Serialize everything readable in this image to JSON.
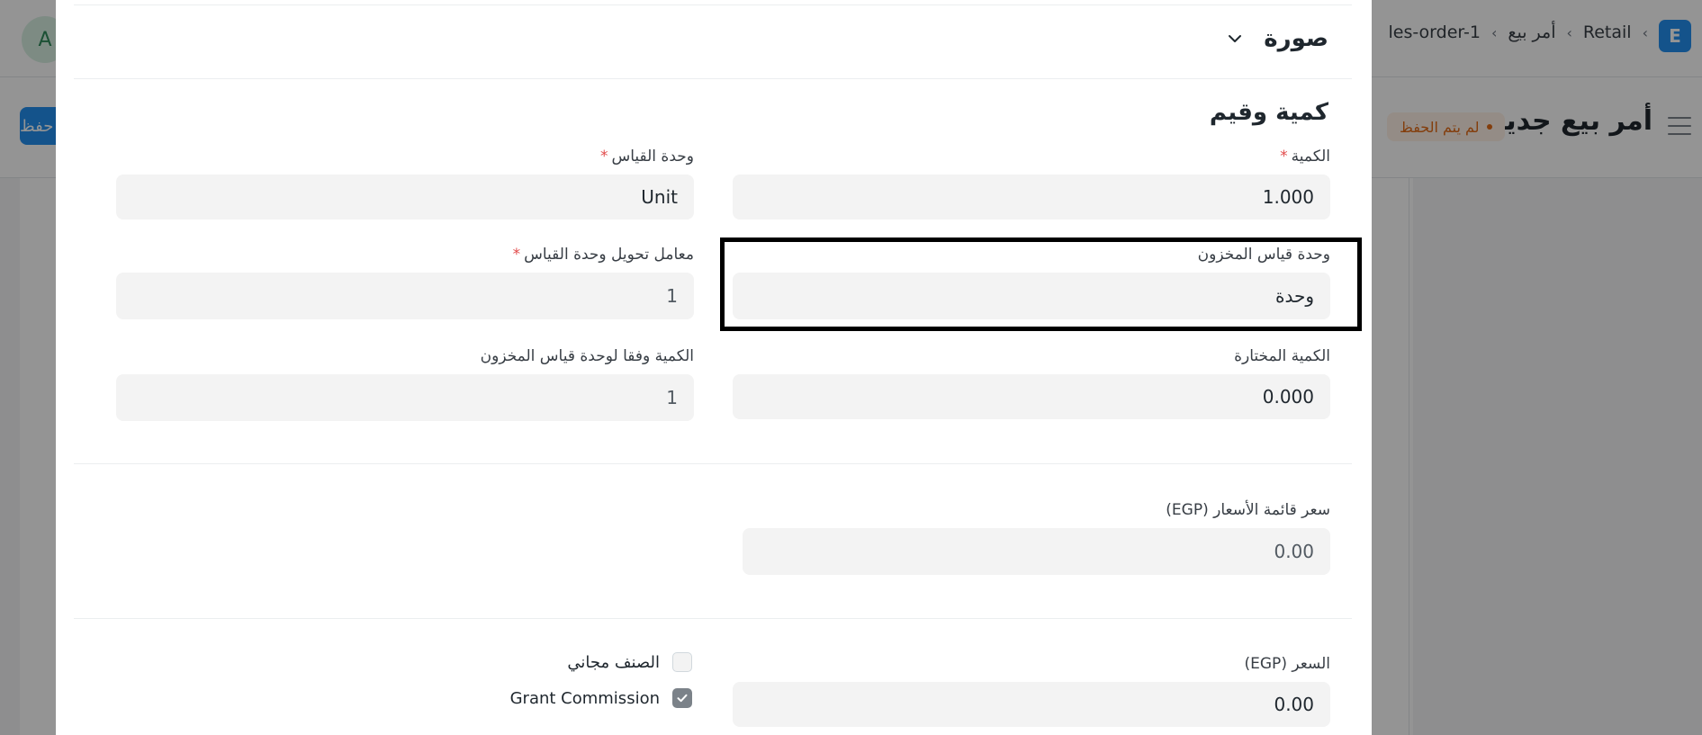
{
  "background": {
    "avatar_letter": "A",
    "app_logo_letter": "E",
    "breadcrumb": [
      "Retail",
      "أمر بيع",
      "les-order-1"
    ],
    "breadcrumb_sep": "›",
    "page_title": "أمر بيع جديد",
    "status": "لم يتم الحفظ",
    "save_label": "حفظ"
  },
  "modal": {
    "collapsible_section": "صورة",
    "section_title": "كمية وقيم",
    "fields": {
      "qty": {
        "label": "الكمية",
        "value": "1.000",
        "required": "*"
      },
      "uom": {
        "label": "وحدة القياس",
        "value": "Unit",
        "required": "*"
      },
      "stock_uom": {
        "label": "وحدة قياس المخزون",
        "value": "وحدة"
      },
      "conversion_factor": {
        "label": "معامل تحويل وحدة القياس",
        "value": "1",
        "required": "*"
      },
      "picked_qty": {
        "label": "الكمية المختارة",
        "value": "0.000"
      },
      "stock_qty": {
        "label": "الكمية وفقا لوحدة قياس المخزون",
        "value": "1"
      },
      "price_list_rate": {
        "label": "سعر قائمة الأسعار (EGP)",
        "value": "0.00"
      },
      "rate": {
        "label": "السعر (EGP)",
        "value": "0.00"
      }
    },
    "checkboxes": {
      "free_item": {
        "label": "الصنف مجاني",
        "checked": false
      },
      "grant_commission": {
        "label": "Grant Commission",
        "checked": true
      }
    }
  }
}
